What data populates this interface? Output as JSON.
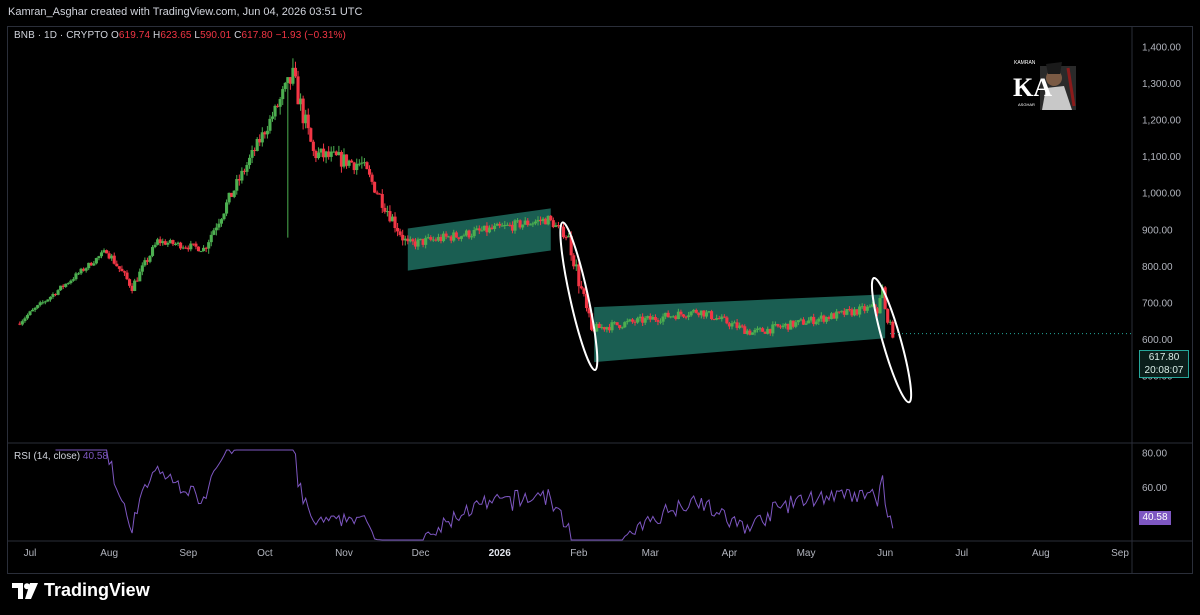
{
  "header": {
    "attribution": "Kamran_Asghar created with TradingView.com, Jun 04, 2026 03:51 UTC"
  },
  "symbol": {
    "label": "BNB · 1D · CRYPTO",
    "o_label": "O",
    "o": "619.74",
    "h_label": "H",
    "h": "623.65",
    "l_label": "L",
    "l": "590.01",
    "c_label": "C",
    "c": "617.80",
    "chg": "−1.93 (−0.31%)"
  },
  "rsi": {
    "label": "RSI (14, close)",
    "value": "40.58"
  },
  "last_price": {
    "price": "617.80",
    "countdown": "20:08:07"
  },
  "brand": {
    "name": "TradingView"
  },
  "avatar_text": {
    "line1": "KAMRAN",
    "line2": "KA",
    "line3": "ASGHAR"
  },
  "colors": {
    "up": "#4caf50",
    "down": "#f23645",
    "channel": "#1f6f60",
    "rsi": "#7e57c2",
    "annotation": "#ffffff"
  },
  "chart_data": [
    {
      "type": "candlestick",
      "title": "BNB · 1D · CRYPTO",
      "y_ticks": [
        500,
        600,
        700,
        800,
        900,
        1000,
        1100,
        1200,
        1300,
        1400
      ],
      "y_tick_labels": [
        "500.00",
        "600.00",
        "700.00",
        "800.00",
        "900.00",
        "1,000.00",
        "1,100.00",
        "1,200.00",
        "1,300.00",
        "1,400.00"
      ],
      "ylim": [
        420,
        1420
      ],
      "x_ticks": [
        "Jul",
        "Aug",
        "Sep",
        "Oct",
        "Nov",
        "Dec",
        "2026",
        "Feb",
        "Mar",
        "Apr",
        "May",
        "Jun",
        "Jul",
        "Aug",
        "Sep"
      ],
      "series": [
        {
          "start": "2025-06-27",
          "end": "2025-07-31",
          "from": 645,
          "to": 845,
          "vol": 8
        },
        {
          "start": "2025-08-01",
          "end": "2025-08-10",
          "from": 845,
          "to": 745,
          "vol": 12
        },
        {
          "start": "2025-08-11",
          "end": "2025-08-20",
          "from": 745,
          "to": 870,
          "vol": 12
        },
        {
          "start": "2025-08-21",
          "end": "2025-09-07",
          "from": 870,
          "to": 850,
          "vol": 10
        },
        {
          "start": "2025-09-08",
          "end": "2025-10-06",
          "from": 850,
          "to": 1240,
          "vol": 18
        },
        {
          "start": "2025-10-07",
          "end": "2025-10-12",
          "from": 1240,
          "to": 1320,
          "vol": 30
        },
        {
          "start": "2025-10-13",
          "end": "2025-10-20",
          "from": 1320,
          "to": 1110,
          "vol": 30
        },
        {
          "start": "2025-10-21",
          "end": "2025-11-08",
          "from": 1110,
          "to": 1080,
          "vol": 22
        },
        {
          "start": "2025-11-09",
          "end": "2025-11-25",
          "from": 1080,
          "to": 870,
          "vol": 20
        },
        {
          "start": "2025-11-26",
          "end": "2026-01-20",
          "from": 860,
          "to": 930,
          "vol": 14
        },
        {
          "start": "2026-01-21",
          "end": "2026-01-28",
          "from": 930,
          "to": 880,
          "vol": 12
        },
        {
          "start": "2026-01-29",
          "end": "2026-02-06",
          "from": 880,
          "to": 620,
          "vol": 25
        },
        {
          "start": "2026-02-07",
          "end": "2026-03-20",
          "from": 630,
          "to": 680,
          "vol": 12
        },
        {
          "start": "2026-03-21",
          "end": "2026-04-10",
          "from": 680,
          "to": 620,
          "vol": 12
        },
        {
          "start": "2026-04-11",
          "end": "2026-05-28",
          "from": 620,
          "to": 690,
          "vol": 12
        },
        {
          "start": "2026-05-29",
          "end": "2026-05-31",
          "from": 650,
          "to": 740,
          "vol": 12
        },
        {
          "start": "2026-06-01",
          "end": "2026-06-04",
          "from": 700,
          "to": 618,
          "vol": 12
        }
      ],
      "channels": [
        {
          "start": "2025-11-26",
          "end": "2026-01-21",
          "top_start": 905,
          "top_end": 960,
          "bottom_start": 790,
          "bottom_end": 845
        },
        {
          "start": "2026-02-07",
          "end": "2026-06-01",
          "top_start": 690,
          "top_end": 725,
          "bottom_start": 540,
          "bottom_end": 605
        }
      ],
      "annotations": [
        {
          "shape": "ellipse",
          "start": "2026-01-26",
          "end": "2026-02-07",
          "top": 910,
          "bottom": 530
        },
        {
          "shape": "ellipse",
          "start": "2026-05-28",
          "end": "2026-06-10",
          "top": 760,
          "bottom": 440
        }
      ]
    },
    {
      "type": "line",
      "title": "RSI (14, close)",
      "y_ticks": [
        60,
        80
      ],
      "y_tick_labels": [
        "60.00",
        "80.00"
      ],
      "ylim": [
        30,
        82
      ],
      "last": 40.58
    }
  ]
}
